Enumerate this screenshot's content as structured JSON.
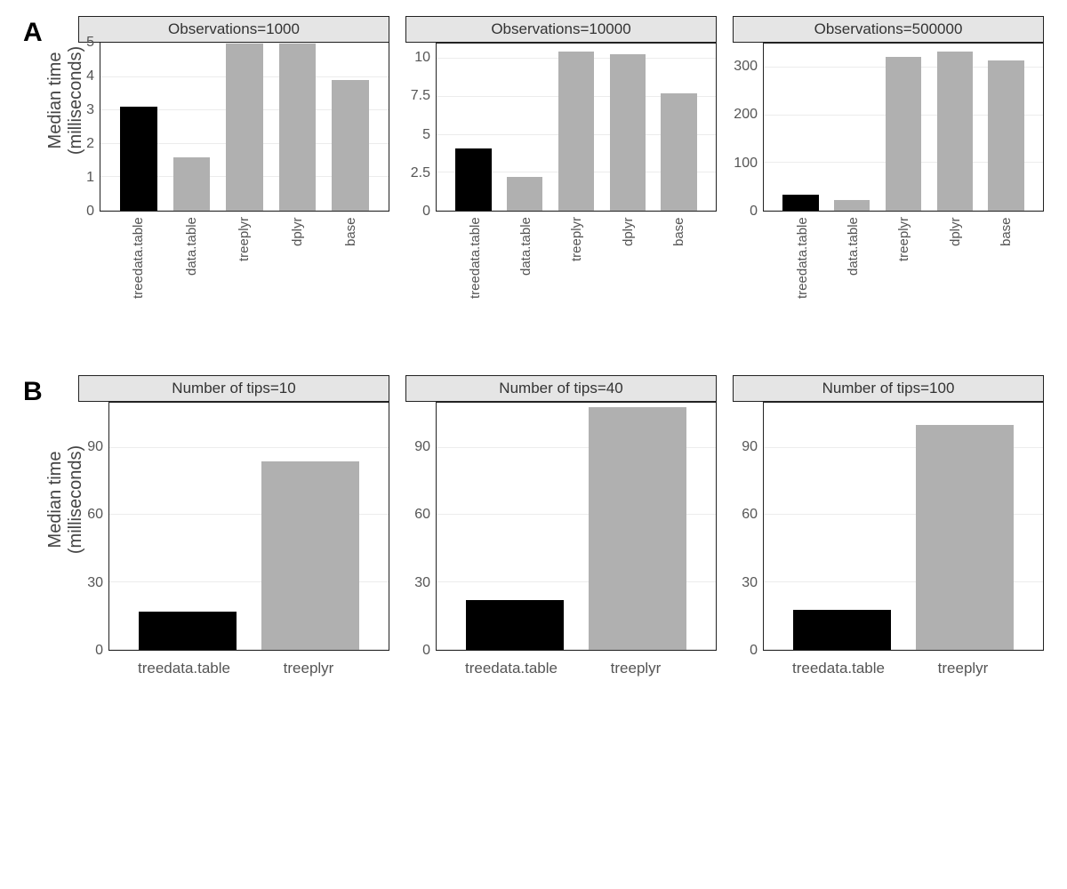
{
  "ylabel": "Median time\n(milliseconds)",
  "panelA": {
    "label": "A",
    "categories": [
      "treedata.table",
      "data.table",
      "treeplyr",
      "dplyr",
      "base"
    ],
    "facets": [
      {
        "strip": "Observations=1000",
        "ymax": 5,
        "yticks": [
          0,
          1,
          2,
          3,
          4,
          5
        ],
        "values": [
          3.1,
          1.6,
          5.0,
          5.1,
          3.9
        ]
      },
      {
        "strip": "Observations=10000",
        "ymax": 11,
        "yticks": [
          0.0,
          2.5,
          5.0,
          7.5,
          10.0
        ],
        "values": [
          4.1,
          2.2,
          10.5,
          10.3,
          7.7
        ]
      },
      {
        "strip": "Observations=500000",
        "ymax": 350,
        "yticks": [
          0,
          100,
          200,
          300
        ],
        "values": [
          33,
          22,
          322,
          333,
          314
        ]
      }
    ]
  },
  "panelB": {
    "label": "B",
    "categories": [
      "treedata.table",
      "treeplyr"
    ],
    "ymax": 110,
    "yticks": [
      0,
      30,
      60,
      90
    ],
    "facets": [
      {
        "strip": "Number of tips=10",
        "values": [
          17,
          84
        ]
      },
      {
        "strip": "Number of tips=40",
        "values": [
          22,
          108
        ]
      },
      {
        "strip": "Number of tips=100",
        "values": [
          18,
          100
        ]
      }
    ]
  },
  "chart_data": [
    {
      "panel": "A",
      "type": "bar",
      "facet_variable": "Observations",
      "ylabel": "Median time (milliseconds)",
      "categories": [
        "treedata.table",
        "data.table",
        "treeplyr",
        "dplyr",
        "base"
      ],
      "highlight": "treedata.table",
      "facets": [
        {
          "Observations": 1000,
          "ylim": [
            0,
            5
          ],
          "values": {
            "treedata.table": 3.1,
            "data.table": 1.6,
            "treeplyr": 5.0,
            "dplyr": 5.1,
            "base": 3.9
          }
        },
        {
          "Observations": 10000,
          "ylim": [
            0,
            11
          ],
          "values": {
            "treedata.table": 4.1,
            "data.table": 2.2,
            "treeplyr": 10.5,
            "dplyr": 10.3,
            "base": 7.7
          }
        },
        {
          "Observations": 500000,
          "ylim": [
            0,
            350
          ],
          "values": {
            "treedata.table": 33,
            "data.table": 22,
            "treeplyr": 322,
            "dplyr": 333,
            "base": 314
          }
        }
      ]
    },
    {
      "panel": "B",
      "type": "bar",
      "facet_variable": "Number of tips",
      "ylabel": "Median time (milliseconds)",
      "categories": [
        "treedata.table",
        "treeplyr"
      ],
      "highlight": "treedata.table",
      "ylim": [
        0,
        110
      ],
      "facets": [
        {
          "Number of tips": 10,
          "values": {
            "treedata.table": 17,
            "treeplyr": 84
          }
        },
        {
          "Number of tips": 40,
          "values": {
            "treedata.table": 22,
            "treeplyr": 108
          }
        },
        {
          "Number of tips": 100,
          "values": {
            "treedata.table": 18,
            "treeplyr": 100
          }
        }
      ]
    }
  ]
}
